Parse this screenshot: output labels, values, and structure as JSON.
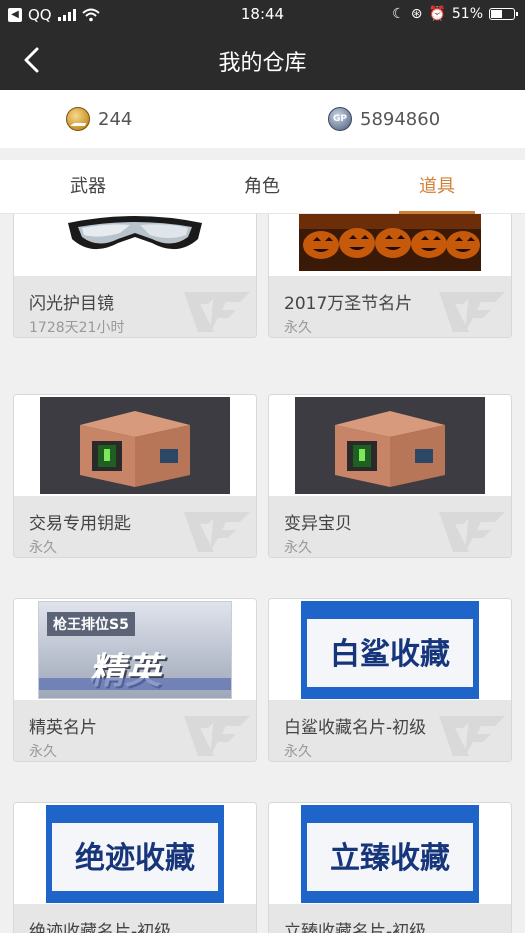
{
  "status_bar": {
    "carrier": "QQ",
    "time": "18:44",
    "battery_percent": "51%"
  },
  "nav": {
    "title": "我的仓库"
  },
  "currency": {
    "coins": "244",
    "gp": "5894860",
    "gp_icon_label": "GP"
  },
  "tabs": [
    {
      "label": "武器",
      "active": false
    },
    {
      "label": "角色",
      "active": false
    },
    {
      "label": "道具",
      "active": true
    }
  ],
  "items": [
    {
      "name": "闪光护目镜",
      "duration": "1728天21小时",
      "image": "goggles"
    },
    {
      "name": "2017万圣节名片",
      "duration": "永久",
      "image": "pumpkins"
    },
    {
      "name": "交易专用钥匙",
      "duration": "永久",
      "image": "crate"
    },
    {
      "name": "变异宝贝",
      "duration": "永久",
      "image": "crate"
    },
    {
      "name": "精英名片",
      "duration": "永久",
      "image": "elite-card",
      "image_text_top": "枪王排位S5",
      "image_text_main": "精英"
    },
    {
      "name": "白鲨收藏名片-初级",
      "duration": "永久",
      "image": "collection-card",
      "image_text_main": "白鲨收藏"
    },
    {
      "name": "绝迹收藏名片-初级",
      "duration": "",
      "image": "collection-card",
      "image_text_main": "绝迹收藏"
    },
    {
      "name": "立臻收藏名片-初级",
      "duration": "",
      "image": "collection-card",
      "image_text_main": "立臻收藏"
    }
  ],
  "colors": {
    "accent": "#d1803a",
    "header": "#2b2b2b"
  }
}
